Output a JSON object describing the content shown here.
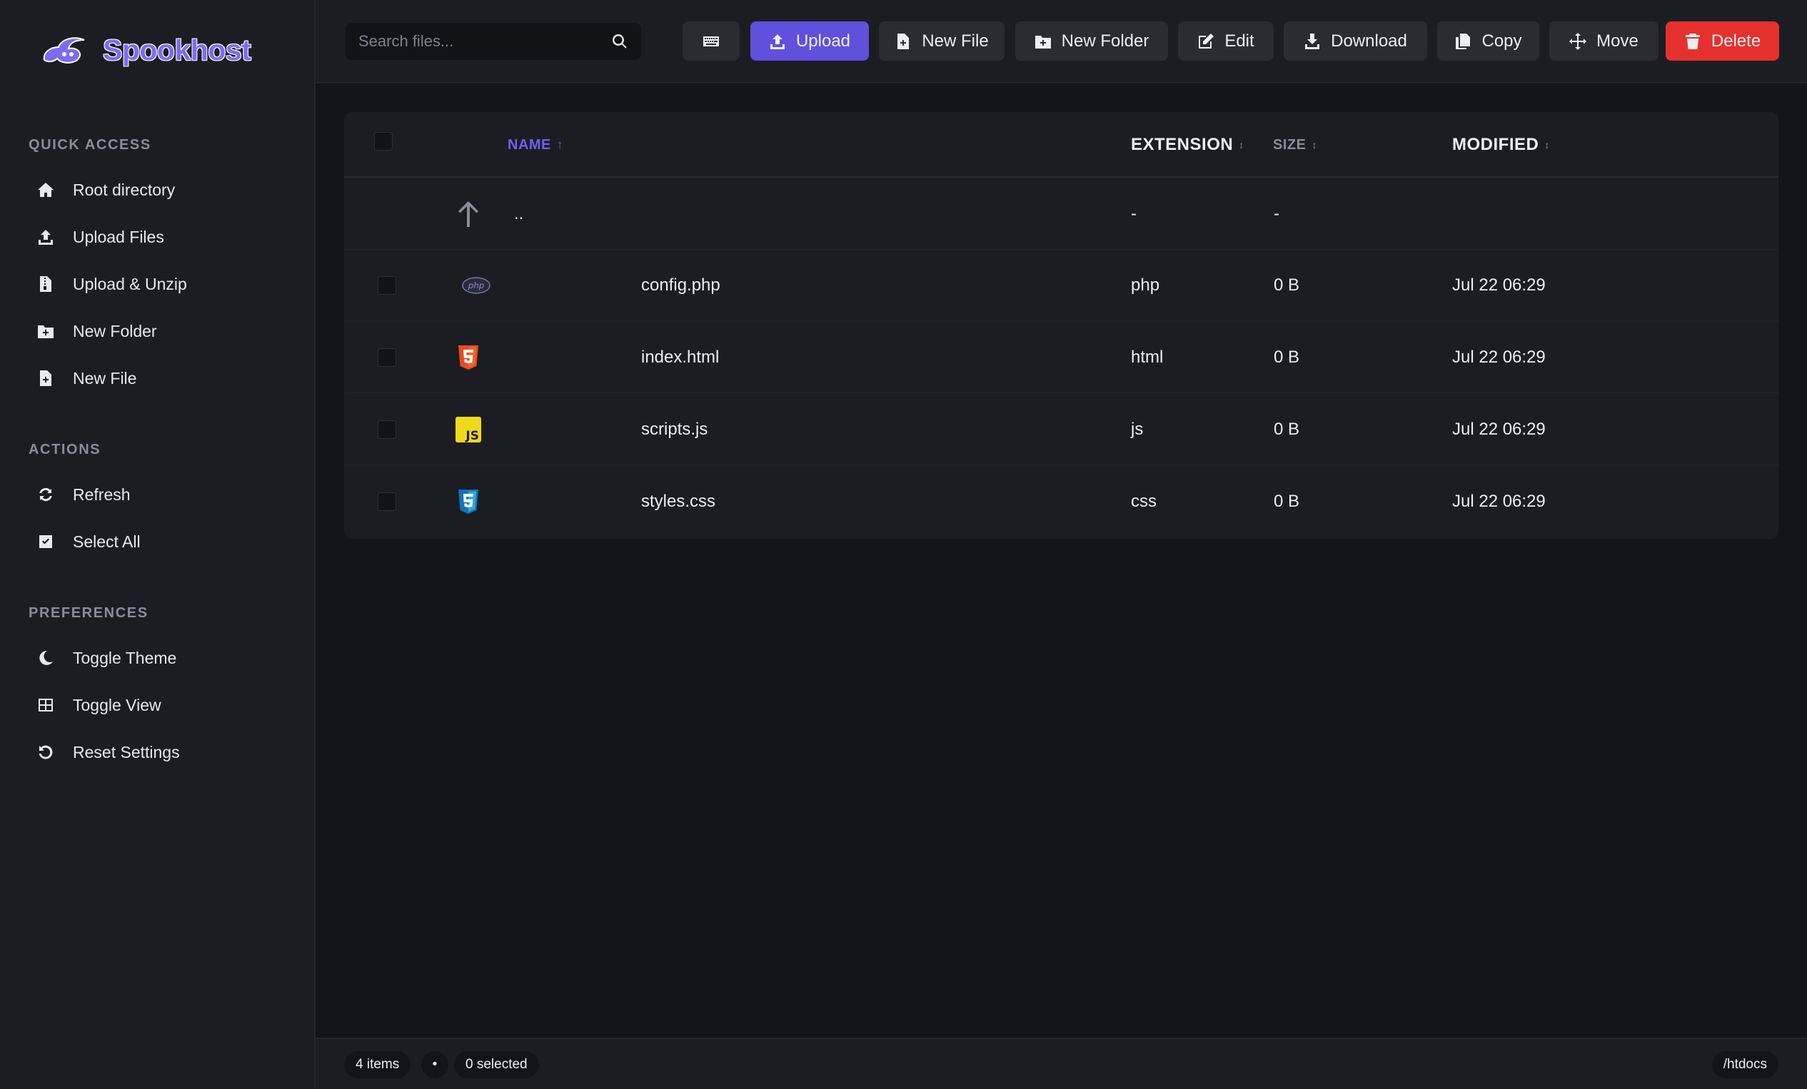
{
  "brand": {
    "name": "Spookhost"
  },
  "sidebar": {
    "sections": [
      {
        "title": "QUICK ACCESS",
        "items": [
          {
            "label": "Root directory",
            "icon": "home-icon"
          },
          {
            "label": "Upload Files",
            "icon": "upload-icon"
          },
          {
            "label": "Upload & Unzip",
            "icon": "file-zip-icon"
          },
          {
            "label": "New Folder",
            "icon": "folder-plus-icon"
          },
          {
            "label": "New File",
            "icon": "file-plus-icon"
          }
        ]
      },
      {
        "title": "ACTIONS",
        "items": [
          {
            "label": "Refresh",
            "icon": "refresh-icon"
          },
          {
            "label": "Select All",
            "icon": "check-square-icon"
          }
        ]
      },
      {
        "title": "PREFERENCES",
        "items": [
          {
            "label": "Toggle Theme",
            "icon": "moon-icon"
          },
          {
            "label": "Toggle View",
            "icon": "grid-icon"
          },
          {
            "label": "Reset Settings",
            "icon": "reset-icon"
          }
        ]
      }
    ]
  },
  "search": {
    "placeholder": "Search files...",
    "value": ""
  },
  "toolbar": {
    "upload": "Upload",
    "new_file": "New File",
    "new_folder": "New Folder",
    "edit": "Edit",
    "download": "Download",
    "copy": "Copy",
    "move": "Move",
    "delete": "Delete"
  },
  "table": {
    "columns": {
      "name": "NAME",
      "extension": "EXTENSION",
      "size": "SIZE",
      "modified": "MODIFIED"
    },
    "sort": {
      "column": "name",
      "direction": "asc"
    },
    "parent_row": {
      "name": "..",
      "extension": "-",
      "size": "-"
    },
    "rows": [
      {
        "name": "config.php",
        "extension": "php",
        "size": "0 B",
        "modified": "Jul 22 06:29",
        "icon": "php-icon"
      },
      {
        "name": "index.html",
        "extension": "html",
        "size": "0 B",
        "modified": "Jul 22 06:29",
        "icon": "html5-icon"
      },
      {
        "name": "scripts.js",
        "extension": "js",
        "size": "0 B",
        "modified": "Jul 22 06:29",
        "icon": "js-icon"
      },
      {
        "name": "styles.css",
        "extension": "css",
        "size": "0 B",
        "modified": "Jul 22 06:29",
        "icon": "css3-icon"
      }
    ]
  },
  "status": {
    "items": "4 items",
    "separator": "•",
    "selected": "0 selected",
    "path": "/htdocs"
  },
  "colors": {
    "accent": "#6050dc",
    "danger": "#e5312e",
    "background": "#131419",
    "panel": "#1c1d23"
  }
}
